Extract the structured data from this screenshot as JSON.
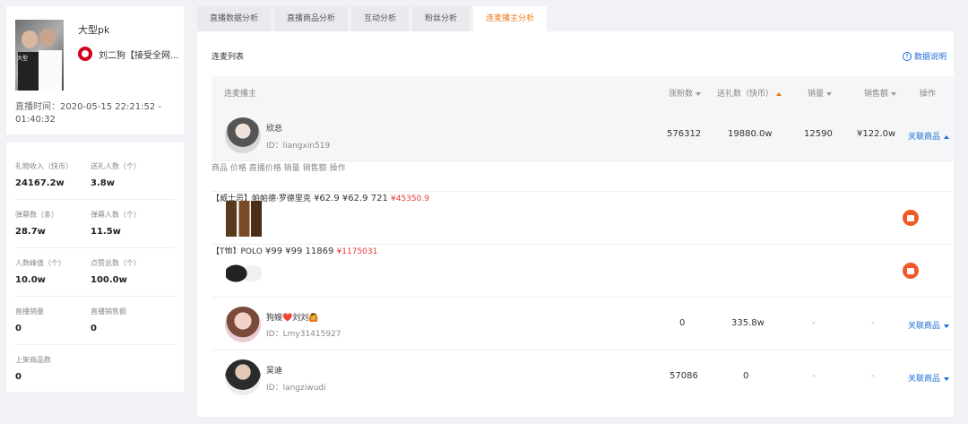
{
  "left": {
    "cover_tag": "大型",
    "title": "大型pk",
    "host_name": "刘二狗【接受全网...",
    "time_label": "直播时间：",
    "time_value": "2020-05-15 22:21:52 - 01:40:32",
    "stats": [
      {
        "label": "礼物收入（快币）",
        "value": "24167.2w"
      },
      {
        "label": "送礼人数（个）",
        "value": "3.8w"
      },
      {
        "label": "弹幕数（条）",
        "value": "28.7w"
      },
      {
        "label": "弹幕人数（个）",
        "value": "11.5w"
      },
      {
        "label": "人数峰值（个）",
        "value": "10.0w"
      },
      {
        "label": "点赞总数（个）",
        "value": "100.0w"
      },
      {
        "label": "直播销量",
        "value": "0"
      },
      {
        "label": "直播销售额",
        "value": "0"
      },
      {
        "label": "上架商品数",
        "value": "0"
      }
    ]
  },
  "tabs": [
    "直播数据分析",
    "直播商品分析",
    "互动分析",
    "粉丝分析",
    "连麦播主分析"
  ],
  "active_tab": 4,
  "panel": {
    "title": "连麦列表",
    "help": "数据说明"
  },
  "table": {
    "headers": {
      "host": "连麦播主",
      "fans": "涨粉数",
      "gift": "送礼数（快币）",
      "sales": "销量",
      "amount": "销售额",
      "action": "操作"
    },
    "rows": [
      {
        "name": "欣总",
        "id": "ID：liangxin519",
        "fans": "576312",
        "gift": "19880.0w",
        "sales": "12590",
        "amount": "¥122.0w",
        "action": "关联商品"
      },
      {
        "name": "狗嫂❤️刘刘🙆",
        "id": "ID：Lmy31415927",
        "fans": "0",
        "gift": "335.8w",
        "sales": "-",
        "amount": "-",
        "action": "关联商品"
      },
      {
        "name": "吴迪",
        "id": "ID：langziwudi",
        "fans": "57086",
        "gift": "0",
        "sales": "-",
        "amount": "-",
        "action": "关联商品"
      }
    ],
    "sub_headers": {
      "product": "商品",
      "price": "价格",
      "live_price": "直播价格",
      "sales": "销量",
      "amount": "销售额",
      "action": "操作"
    },
    "products": [
      {
        "name": "【威士忌】帕帕德·罗德里克",
        "price": "¥62.9",
        "live_price": "¥62.9",
        "sales": "721",
        "amount": "¥45350.9"
      },
      {
        "name": "【T恤】POLO",
        "price": "¥99",
        "live_price": "¥99",
        "sales": "11869",
        "amount": "¥1175031"
      }
    ]
  },
  "colors": {
    "accent": "#e87a1a",
    "link": "#1e6fd9",
    "red": "#e53935",
    "shop": "#f05a28"
  }
}
